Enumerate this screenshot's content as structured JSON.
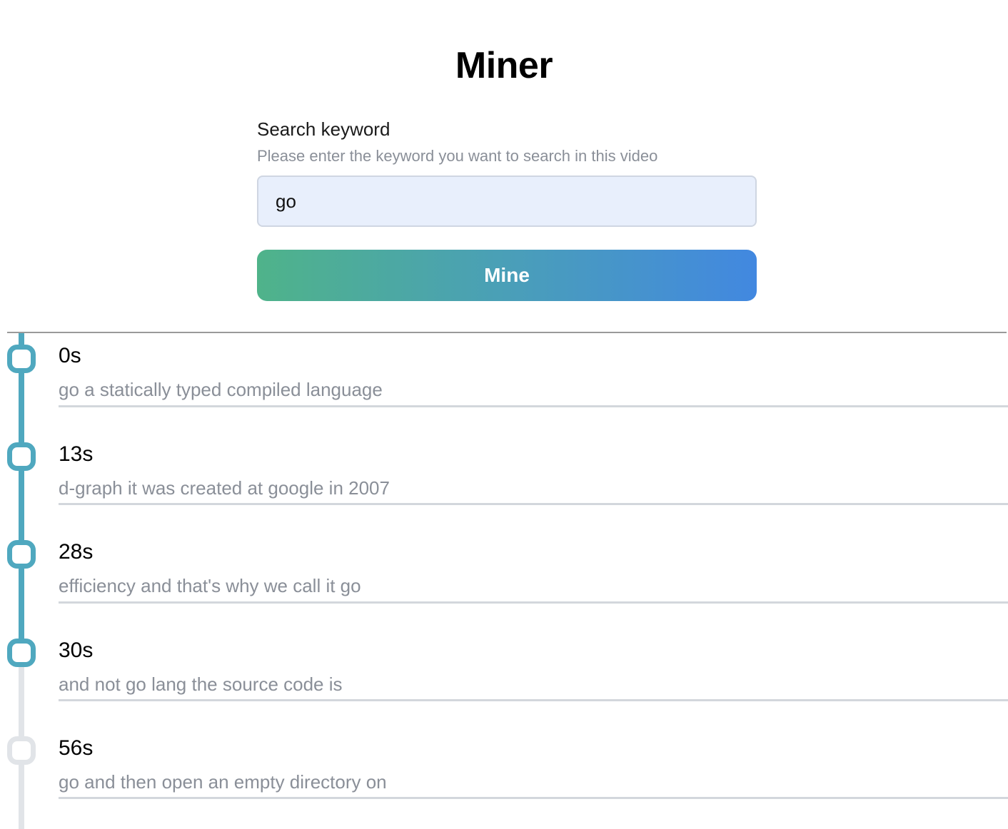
{
  "page": {
    "title": "Miner"
  },
  "search": {
    "label": "Search keyword",
    "help": "Please enter the keyword you want to search in this video",
    "value": "go",
    "button_label": "Mine"
  },
  "colors": {
    "accent": "#4fa8bf",
    "inactive": "#e1e4e8",
    "button_gradient_start": "#4fb38a",
    "button_gradient_end": "#4288e0",
    "input_background": "#e8effc"
  },
  "results": [
    {
      "time": "0s",
      "text": "go a statically typed compiled language",
      "active": true
    },
    {
      "time": "13s",
      "text": "d-graph it was created at google in 2007",
      "active": true
    },
    {
      "time": "28s",
      "text": "efficiency and that's why we call it go",
      "active": true
    },
    {
      "time": "30s",
      "text": "and not go lang the source code is",
      "active": true
    },
    {
      "time": "56s",
      "text": "go and then open an empty directory on",
      "active": false
    }
  ]
}
